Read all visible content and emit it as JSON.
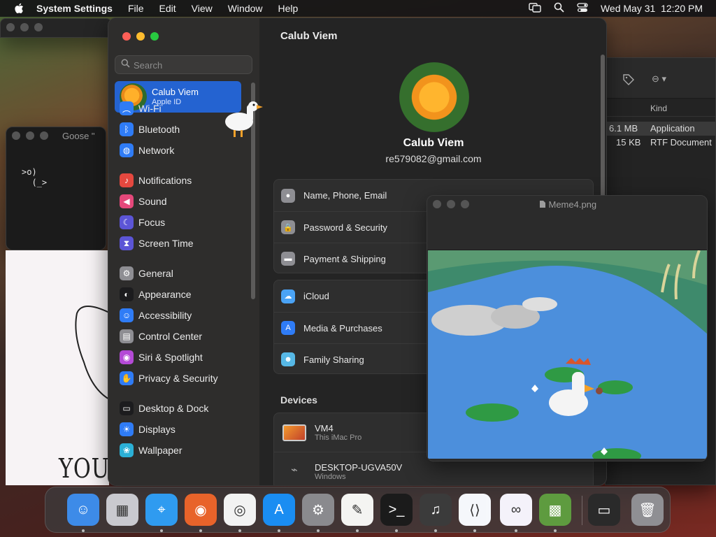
{
  "menubar": {
    "app_name": "System Settings",
    "menus": [
      "File",
      "Edit",
      "View",
      "Window",
      "Help"
    ],
    "datetime": "Wed May 31  12:20 PM"
  },
  "goose_window": {
    "title": "Goose \"",
    "art_line1": ">o)",
    "art_line2": "  (_>"
  },
  "doodle": {
    "text": "YOU"
  },
  "finder": {
    "column_kind": "Kind",
    "rows": [
      {
        "size": "6.1 MB",
        "kind": "Application"
      },
      {
        "size": "15 KB",
        "kind": "RTF Document"
      }
    ]
  },
  "settings": {
    "search_placeholder": "Search",
    "account": {
      "name": "Calub Viem",
      "subtitle": "Apple ID"
    },
    "sidebar_items": [
      {
        "label": "Wi-Fi",
        "icon": "wifi-icon",
        "color": "#2f7cf6"
      },
      {
        "label": "Bluetooth",
        "icon": "bluetooth-icon",
        "color": "#2f7cf6"
      },
      {
        "label": "Network",
        "icon": "globe-icon",
        "color": "#2f7cf6"
      },
      {
        "label": "Notifications",
        "icon": "bell-icon",
        "color": "#e5483f"
      },
      {
        "label": "Sound",
        "icon": "speaker-icon",
        "color": "#e5487a"
      },
      {
        "label": "Focus",
        "icon": "moon-icon",
        "color": "#5c55d6"
      },
      {
        "label": "Screen Time",
        "icon": "hourglass-icon",
        "color": "#5c55d6"
      },
      {
        "label": "General",
        "icon": "gear-icon",
        "color": "#8e8e93"
      },
      {
        "label": "Appearance",
        "icon": "appearance-icon",
        "color": "#1c1c1e"
      },
      {
        "label": "Accessibility",
        "icon": "accessibility-icon",
        "color": "#2f7cf6"
      },
      {
        "label": "Control Center",
        "icon": "control-center-icon",
        "color": "#8e8e93"
      },
      {
        "label": "Siri & Spotlight",
        "icon": "siri-icon",
        "color": "#b44ad6"
      },
      {
        "label": "Privacy & Security",
        "icon": "hand-icon",
        "color": "#2f7cf6"
      },
      {
        "label": "Desktop & Dock",
        "icon": "dock-icon",
        "color": "#1c1c1e"
      },
      {
        "label": "Displays",
        "icon": "sun-icon",
        "color": "#2f7cf6"
      },
      {
        "label": "Wallpaper",
        "icon": "wallpaper-icon",
        "color": "#2bb0d6"
      }
    ],
    "content": {
      "title": "Calub Viem",
      "profile_name": "Calub Viem",
      "email": "re579082@gmail.com",
      "group1": [
        {
          "label": "Name, Phone, Email",
          "icon": "person-icon",
          "color": "#8e8e93"
        },
        {
          "label": "Password & Security",
          "icon": "lock-icon",
          "color": "#8e8e93"
        },
        {
          "label": "Payment & Shipping",
          "icon": "card-icon",
          "color": "#8e8e93"
        }
      ],
      "group2": [
        {
          "label": "iCloud",
          "icon": "cloud-icon",
          "color": "#4aa3f5"
        },
        {
          "label": "Media & Purchases",
          "icon": "app-store-icon",
          "color": "#2f7cf6"
        },
        {
          "label": "Family Sharing",
          "icon": "family-icon",
          "color": "#56b8e6"
        }
      ],
      "devices_heading": "Devices",
      "devices": [
        {
          "name": "VM4",
          "sub": "This iMac Pro",
          "icon": "imac-icon"
        },
        {
          "name": "DESKTOP-UGVA50V",
          "sub": "Windows",
          "icon": "pc-icon"
        }
      ]
    }
  },
  "preview": {
    "title": "Meme4.png"
  },
  "dock": [
    {
      "name": "finder",
      "color": "#3d8be8",
      "running": true
    },
    {
      "name": "launchpad",
      "color": "#c9c9cf",
      "running": false
    },
    {
      "name": "safari",
      "color": "#2f9bf0",
      "running": true
    },
    {
      "name": "firefox",
      "color": "#e8632a",
      "running": true
    },
    {
      "name": "chrome",
      "color": "#f2f2f2",
      "running": true
    },
    {
      "name": "app-store",
      "color": "#1a8df2",
      "running": true
    },
    {
      "name": "system-settings",
      "color": "#8a8a8e",
      "running": true
    },
    {
      "name": "textedit",
      "color": "#f4f4f2",
      "running": true
    },
    {
      "name": "terminal",
      "color": "#1b1b1b",
      "running": true
    },
    {
      "name": "garageband",
      "color": "#3b3b3b",
      "running": true
    },
    {
      "name": "vscode",
      "color": "#f5f7fb",
      "running": true
    },
    {
      "name": "visual-studio",
      "color": "#f4f2fa",
      "running": true
    },
    {
      "name": "minecraft",
      "color": "#5e9b3f",
      "running": true
    },
    {
      "name": "preview-minimized",
      "color": "#2a2a2a",
      "running": false
    },
    {
      "name": "trash",
      "color": "#8f8f93",
      "running": false
    }
  ]
}
